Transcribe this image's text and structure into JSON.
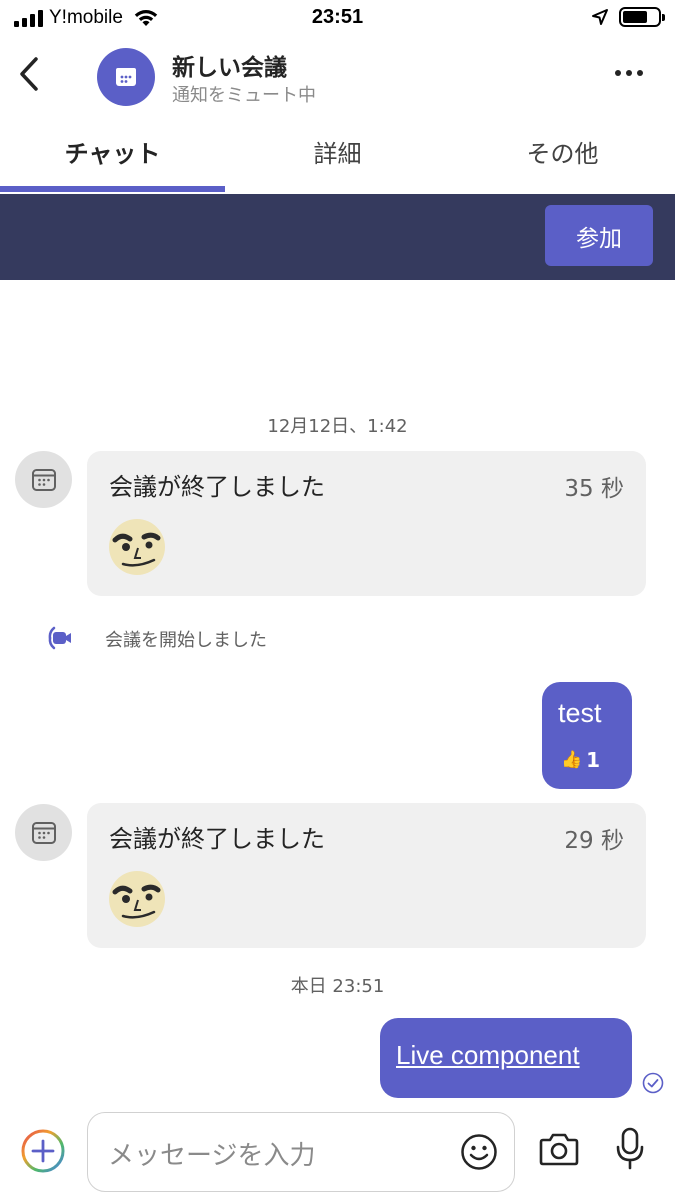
{
  "status_bar": {
    "carrier": "Y!mobile",
    "time": "23:51"
  },
  "header": {
    "title": "新しい会議",
    "subtitle": "通知をミュート中",
    "avatar_icon": "calendar-icon"
  },
  "tabs": [
    {
      "label": "チャット",
      "active": true
    },
    {
      "label": "詳細",
      "active": false
    },
    {
      "label": "その他",
      "active": false
    }
  ],
  "banner": {
    "join_label": "参加"
  },
  "chat": {
    "date_1": "12月12日、1:42",
    "meeting_1": {
      "title": "会議が終了しました",
      "duration": "35 秒"
    },
    "event": "会議を開始しました",
    "my_message_1": {
      "text": "test",
      "reaction_emoji": "👍",
      "reaction_count": "1"
    },
    "meeting_2": {
      "title": "会議が終了しました",
      "duration": "29 秒"
    },
    "date_2": "本日 23:51",
    "my_message_2": {
      "text": "Live component"
    }
  },
  "composer": {
    "placeholder": "メッセージを入力"
  },
  "colors": {
    "accent": "#5b5fc7",
    "banner": "#353a5e",
    "card": "#f0f0f0"
  }
}
